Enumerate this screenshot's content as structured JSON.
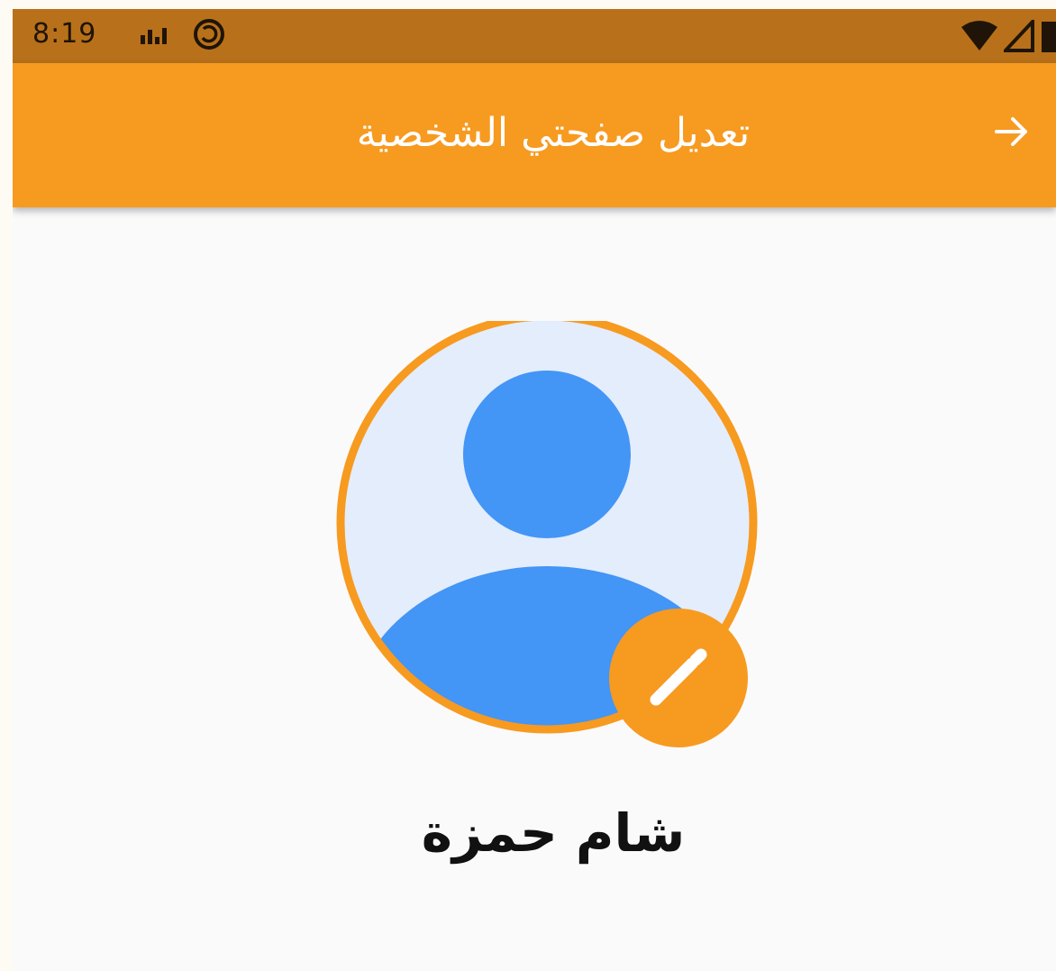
{
  "status_bar": {
    "time": "8:19",
    "left_icons": [
      "signal-bars-icon",
      "sync-icon"
    ],
    "right_icons": [
      "wifi-icon",
      "cellular-icon",
      "battery-icon"
    ],
    "color": "#b8711a"
  },
  "app_bar": {
    "title": "تعديل صفحتي الشخصية",
    "back_icon": "arrow-right-icon",
    "color": "#f79a20"
  },
  "profile": {
    "name": "شام حمزة",
    "avatar_icon": "default-user-avatar-icon",
    "edit_icon": "pencil-icon",
    "accent_color": "#f79a20",
    "avatar_color": "#4395f6",
    "avatar_bg": "#e3edfc"
  }
}
